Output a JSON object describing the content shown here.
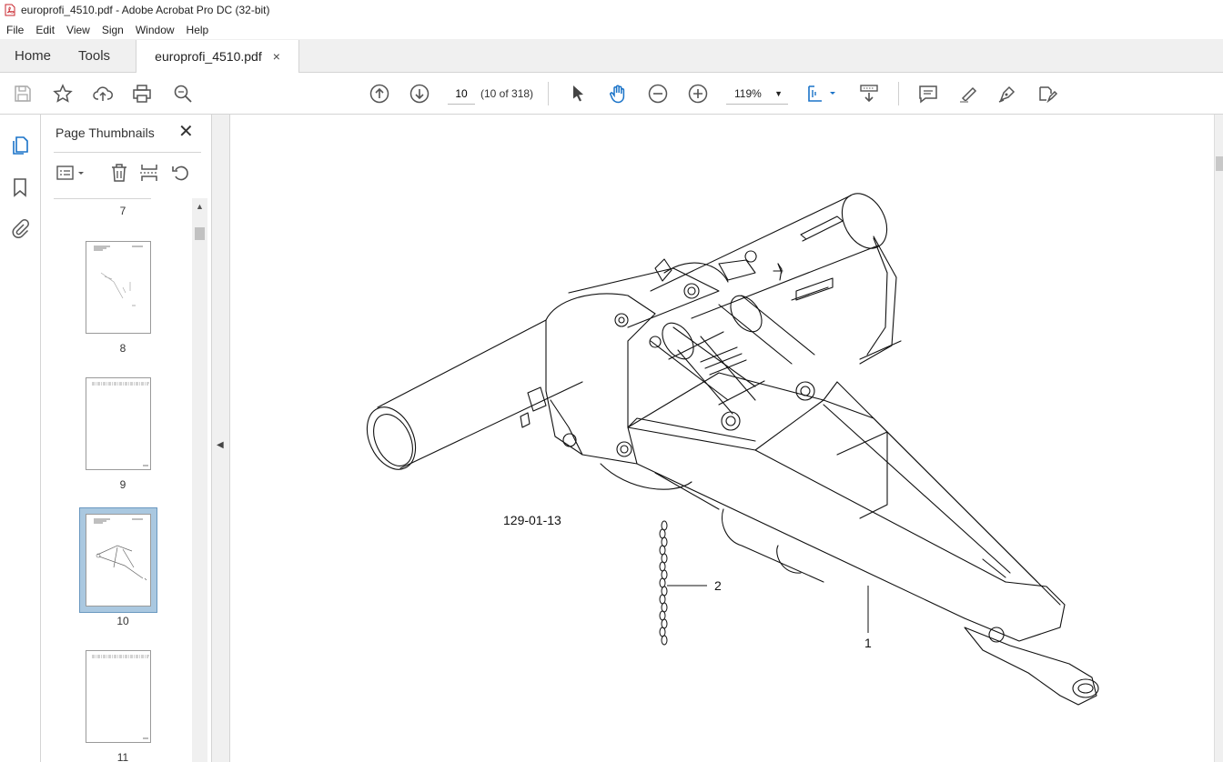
{
  "window": {
    "title": "europrofi_4510.pdf - Adobe Acrobat Pro DC (32-bit)"
  },
  "menu": [
    "File",
    "Edit",
    "View",
    "Sign",
    "Window",
    "Help"
  ],
  "tabs": {
    "home": "Home",
    "tools": "Tools",
    "document": "europrofi_4510.pdf",
    "close": "×"
  },
  "toolbar": {
    "page_input": "10",
    "page_of": "(10 of 318)",
    "zoom": "119%"
  },
  "panel": {
    "title": "Page Thumbnails",
    "close": "✕",
    "thumbnails": [
      {
        "page": "7"
      },
      {
        "page": "8"
      },
      {
        "page": "9"
      },
      {
        "page": "10",
        "selected": true
      },
      {
        "page": "11"
      }
    ]
  },
  "drawing": {
    "figure_code": "129-01-13",
    "callout_1": "1",
    "callout_2": "2"
  },
  "colors": {
    "accent_blue": "#1a73c8",
    "selection": "#aac8e0"
  }
}
